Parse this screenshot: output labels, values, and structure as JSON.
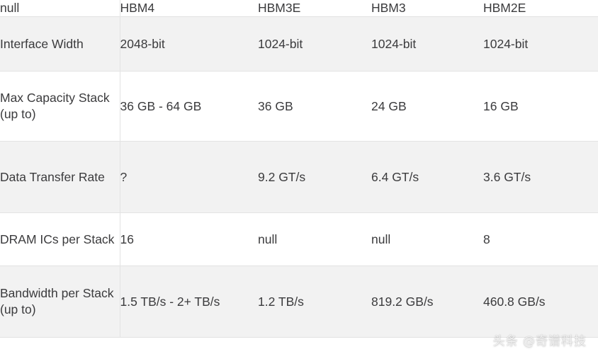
{
  "table": {
    "columns": [
      "null",
      "HBM4",
      "HBM3E",
      "HBM3",
      "HBM2E"
    ],
    "rows": [
      {
        "label": "Interface Width",
        "values": [
          "2048-bit",
          "1024-bit",
          "1024-bit",
          "1024-bit"
        ]
      },
      {
        "label": "Max Capacity Stack (up to)",
        "values": [
          "36 GB - 64 GB",
          "36 GB",
          "24 GB",
          "16 GB"
        ]
      },
      {
        "label": "Data Transfer Rate",
        "values": [
          "?",
          "9.2 GT/s",
          "6.4 GT/s",
          "3.6 GT/s"
        ]
      },
      {
        "label": "DRAM ICs per Stack",
        "values": [
          "16",
          "null",
          "null",
          "8"
        ]
      },
      {
        "label": "Bandwidth per Stack (up to)",
        "values": [
          "1.5 TB/s - 2+ TB/s",
          "1.2 TB/s",
          "819.2 GB/s",
          "460.8 GB/s"
        ]
      }
    ]
  },
  "watermark": {
    "text": "头条 @奇谱科技"
  },
  "colors": {
    "row_alt_background": "#f2f2f2",
    "row_background": "#ffffff",
    "text": "#3b3b3d",
    "border": "#e3e3e3"
  }
}
